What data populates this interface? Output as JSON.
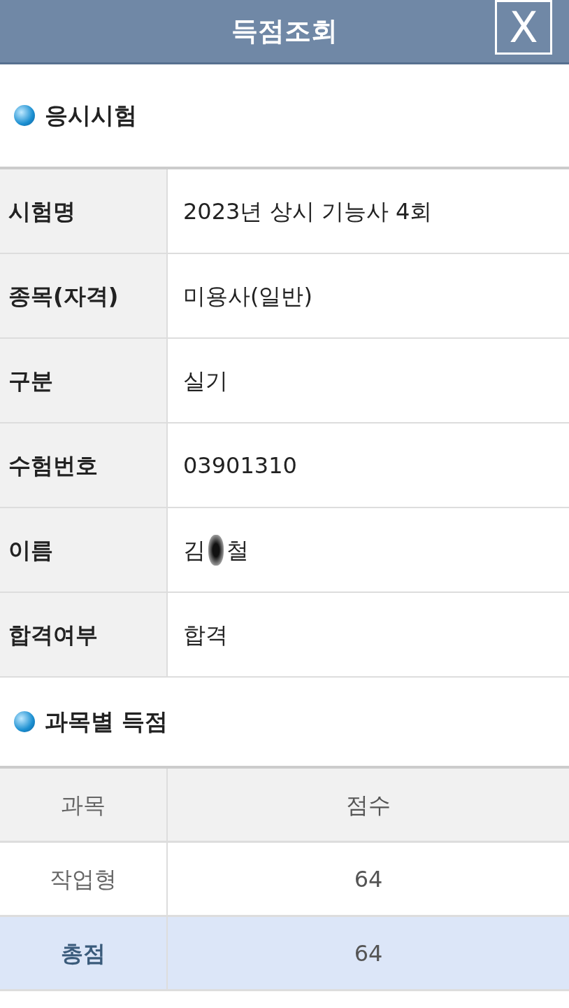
{
  "header": {
    "title": "득점조회",
    "close": "X"
  },
  "exam_section": {
    "title": "응시시험",
    "rows": [
      {
        "label": "시험명",
        "value": "2023년 상시 기능사 4회"
      },
      {
        "label": "종목(자격)",
        "value": "미용사(일반)"
      },
      {
        "label": "구분",
        "value": "실기"
      },
      {
        "label": "수험번호",
        "value": "03901310"
      },
      {
        "label": "이름",
        "kind": "redacted",
        "parts": [
          "김",
          "철"
        ]
      },
      {
        "label": "합격여부",
        "value": "합격"
      }
    ]
  },
  "score_section": {
    "title": "과목별 득점",
    "columns": [
      "과목",
      "점수"
    ],
    "rows": [
      {
        "kind": "subject",
        "subject": "작업형",
        "score": "64"
      },
      {
        "kind": "total",
        "subject": "총점",
        "score": "64"
      }
    ]
  }
}
